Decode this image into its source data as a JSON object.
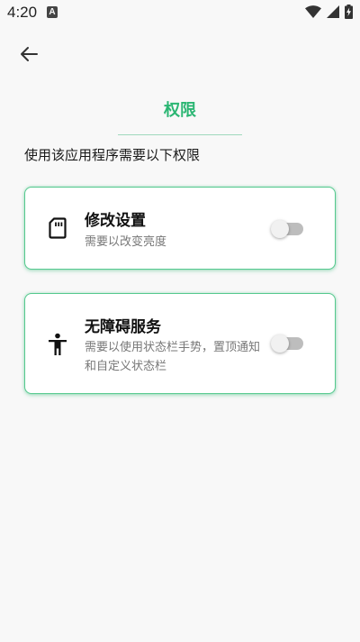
{
  "status_bar": {
    "time": "4:20",
    "notification_icon": "A"
  },
  "header": {
    "back_icon": "arrow-left-icon",
    "title": "权限"
  },
  "intro": "使用该应用程序需要以下权限",
  "permissions": [
    {
      "icon": "sd-card-icon",
      "title": "修改设置",
      "description": "需要以改变亮度",
      "enabled": false
    },
    {
      "icon": "accessibility-icon",
      "title": "无障碍服务",
      "description": "需要以使用状态栏手势，置顶通知和自定义状态栏",
      "enabled": false
    }
  ],
  "colors": {
    "accent": "#2bb673",
    "card_border": "#55c98e",
    "background": "#f8f8f8"
  }
}
